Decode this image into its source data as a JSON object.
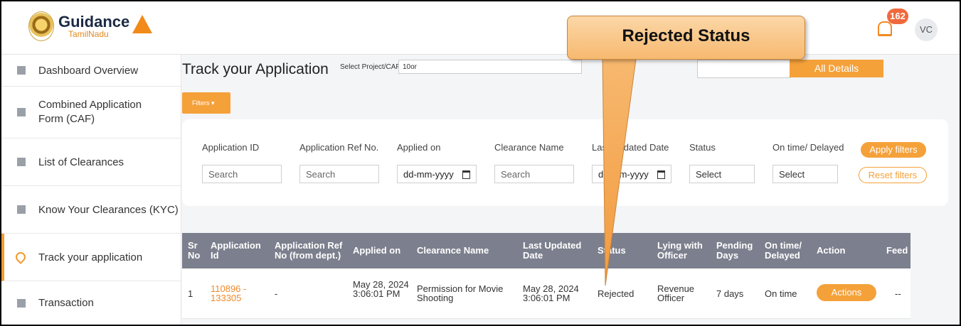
{
  "header": {
    "logo_main": "Guidance",
    "logo_sub": "TamilNadu",
    "notification_count": "162",
    "avatar_initials": "VC"
  },
  "sidebar": {
    "items": [
      {
        "label": "Dashboard Overview",
        "icon": "grid-icon"
      },
      {
        "label": "Combined Application Form (CAF)",
        "icon": "document-icon"
      },
      {
        "label": "List of Clearances",
        "icon": "list-icon"
      },
      {
        "label": "Know Your Clearances (KYC)",
        "icon": "book-icon"
      },
      {
        "label": "Track your application",
        "icon": "location-pin-icon",
        "active": true
      },
      {
        "label": "Transaction",
        "icon": "card-icon"
      }
    ]
  },
  "main": {
    "title": "Track your Application",
    "project_label": "Select Project/CAF",
    "project_value": "10or",
    "all_details_label": "All Details",
    "filters_label": "Filters",
    "filters": {
      "application_id": {
        "label": "Application ID",
        "placeholder": "Search"
      },
      "application_ref": {
        "label": "Application Ref No.",
        "placeholder": "Search"
      },
      "applied_on": {
        "label": "Applied on",
        "placeholder": "dd-mm-yyyy"
      },
      "clearance_name": {
        "label": "Clearance Name",
        "placeholder": "Search"
      },
      "last_updated": {
        "label": "Last Updated Date",
        "placeholder": "dd-mm-yyyy"
      },
      "status": {
        "label": "Status",
        "value": "Select"
      },
      "on_time": {
        "label": "On time/ Delayed",
        "value": "Select"
      },
      "apply_label": "Apply filters",
      "reset_label": "Reset filters"
    },
    "table": {
      "headers": [
        "Sr No",
        "Application Id",
        "Application Ref No (from dept.)",
        "Applied on",
        "Clearance Name",
        "Last Updated Date",
        "Status",
        "Lying with Officer",
        "Pending Days",
        "On time/ Delayed",
        "Action",
        "Feed"
      ],
      "rows": [
        {
          "sr": "1",
          "application_id": "110896 - 133305",
          "ref_no": "-",
          "applied_on": "May 28, 2024 3:06:01 PM",
          "clearance_name": "Permission for Movie Shooting",
          "last_updated": "May 28, 2024 3:06:01 PM",
          "status": "Rejected",
          "lying_with": "Revenue Officer",
          "pending_days": "7 days",
          "on_time": "On time",
          "action_label": "Actions",
          "feedback": "--"
        }
      ]
    }
  },
  "callout": {
    "text": "Rejected Status"
  },
  "colors": {
    "accent": "#f5a13a",
    "table_header": "#7c7f8d",
    "link": "#ef8a2a"
  }
}
